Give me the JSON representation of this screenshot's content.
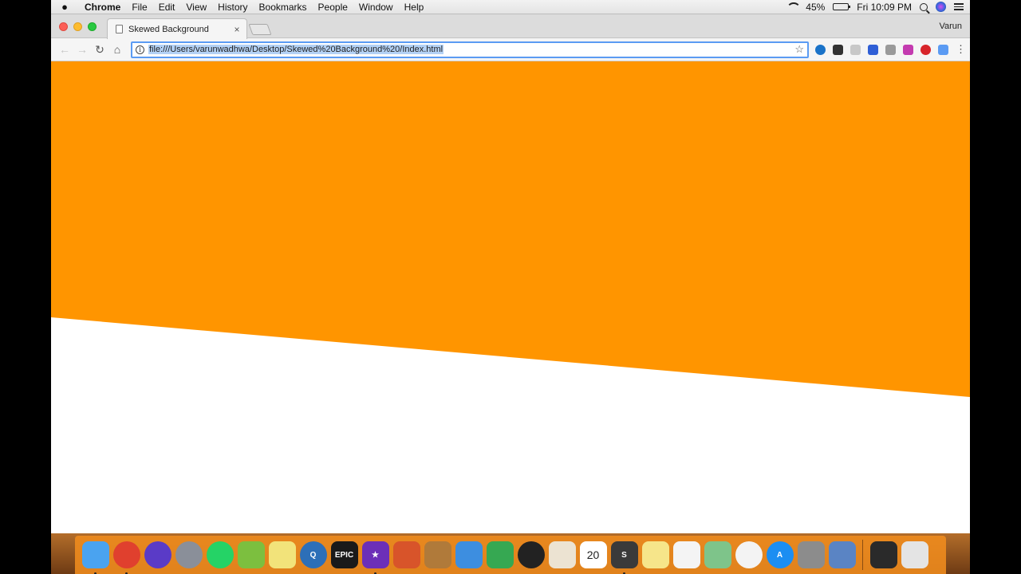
{
  "menubar": {
    "app_name": "Chrome",
    "items": [
      "File",
      "Edit",
      "View",
      "History",
      "Bookmarks",
      "People",
      "Window",
      "Help"
    ],
    "battery": "45%",
    "clock": "Fri 10:09 PM"
  },
  "browser": {
    "tab_title": "Skewed Background",
    "tab_close": "×",
    "profile_name": "Varun",
    "url": "file:///Users/varunwadhwa/Desktop/Skewed%20Background%20/Index.html",
    "back": "←",
    "forward": "→",
    "reload": "↻",
    "home": "⌂",
    "star": "☆",
    "menu": "⋮",
    "extensions": [
      "#1a73c9",
      "#333333",
      "#c8c8c8",
      "#2f5fd6",
      "#9a9a9a",
      "#c43bb0",
      "#d8242a",
      "#5b9bf3"
    ]
  },
  "page": {
    "skew_color": "#ff9500",
    "background": "#ffffff"
  },
  "dock": {
    "items": [
      {
        "name": "finder",
        "color": "#4aa3f0",
        "label": "",
        "running": true
      },
      {
        "name": "chrome",
        "color": "#e0402e",
        "label": "",
        "running": true
      },
      {
        "name": "siri",
        "color": "#5a3bc7",
        "label": "",
        "running": false
      },
      {
        "name": "launchpad",
        "color": "#8a8f99",
        "label": "",
        "running": false
      },
      {
        "name": "whatsapp",
        "color": "#25d366",
        "label": "",
        "running": false
      },
      {
        "name": "android-studio",
        "color": "#7cbf3f",
        "label": "",
        "running": false
      },
      {
        "name": "stickies",
        "color": "#f2e37a",
        "label": "",
        "running": false
      },
      {
        "name": "quicktime",
        "color": "#2d6fb8",
        "label": "Q",
        "running": false
      },
      {
        "name": "epic-games",
        "color": "#1a1a1a",
        "label": "EPIC",
        "running": false
      },
      {
        "name": "imovie",
        "color": "#6c2fb8",
        "label": "★",
        "running": true
      },
      {
        "name": "photo-booth",
        "color": "#d8542a",
        "label": "",
        "running": false
      },
      {
        "name": "notefile",
        "color": "#b07a3a",
        "label": "",
        "running": false
      },
      {
        "name": "keynote",
        "color": "#3d8ee0",
        "label": "",
        "running": false
      },
      {
        "name": "numbers",
        "color": "#36a852",
        "label": "",
        "running": false
      },
      {
        "name": "dashboard",
        "color": "#222222",
        "label": "",
        "running": false
      },
      {
        "name": "textedit",
        "color": "#ece3d2",
        "label": "",
        "running": false
      },
      {
        "name": "calendar",
        "color": "#ffffff",
        "label": "20",
        "running": false
      },
      {
        "name": "sublime",
        "color": "#3a3a3a",
        "label": "S",
        "running": true
      },
      {
        "name": "notes",
        "color": "#f6e58a",
        "label": "",
        "running": false
      },
      {
        "name": "reminders",
        "color": "#f4f4f4",
        "label": "",
        "running": false
      },
      {
        "name": "maps",
        "color": "#7ec48a",
        "label": "",
        "running": false
      },
      {
        "name": "photos",
        "color": "#f3f3f3",
        "label": "",
        "running": false
      },
      {
        "name": "app-store",
        "color": "#1c8ef2",
        "label": "A",
        "running": false
      },
      {
        "name": "system-preferences",
        "color": "#8c8c8c",
        "label": "",
        "running": false
      },
      {
        "name": "preview",
        "color": "#5a84c4",
        "label": "",
        "running": false
      }
    ],
    "stack_items": [
      {
        "name": "screenshot-stack",
        "color": "#2a2a2a"
      },
      {
        "name": "trash",
        "color": "#e4e4e4"
      }
    ]
  }
}
